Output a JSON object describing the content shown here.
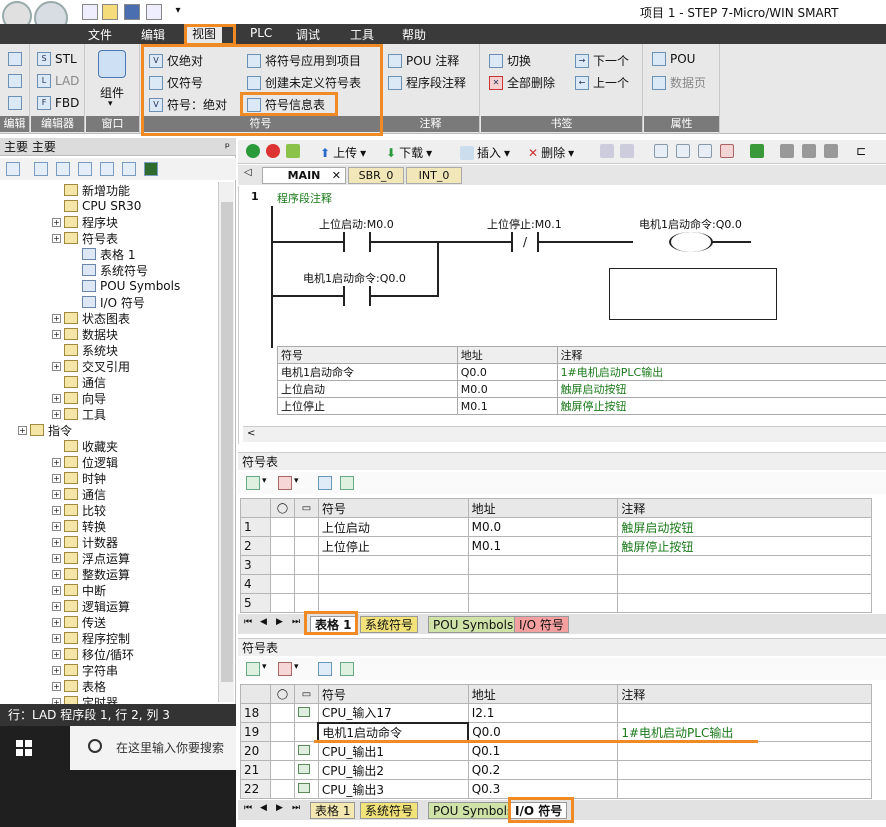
{
  "window": {
    "title": "项目 1 - STEP 7-Micro/WIN SMART"
  },
  "menu": [
    "文件",
    "编辑",
    "视图",
    "PLC",
    "调试",
    "工具",
    "帮助"
  ],
  "ribbon": {
    "editor_group": {
      "items": [
        "STL",
        "LAD",
        "FBD"
      ],
      "label": "编辑器"
    },
    "window_group": {
      "item": "组件",
      "label": "窗口"
    },
    "symbol_group": {
      "items": [
        "仅绝对",
        "仅符号",
        "符号：绝对",
        "将符号应用到项目",
        "创建未定义符号表",
        "符号信息表"
      ],
      "label": "符号"
    },
    "comment_group": {
      "items": [
        "POU 注释",
        "程序段注释"
      ],
      "label": "注释"
    },
    "bookmark_group": {
      "items": [
        "切换",
        "全部删除",
        "下一个",
        "上一个"
      ],
      "label": "书签"
    },
    "prop_group": {
      "items": [
        "POU",
        "数据页"
      ],
      "label": "属性"
    },
    "left_clip": "编辑"
  },
  "left_panel": {
    "header": "主要 主要",
    "tree": [
      {
        "label": "新增功能",
        "level": 2,
        "exp": false
      },
      {
        "label": "CPU SR30",
        "level": 2,
        "exp": false
      },
      {
        "label": "程序块",
        "level": 2,
        "exp": true
      },
      {
        "label": "符号表",
        "level": 2,
        "exp": true
      },
      {
        "label": "表格 1",
        "level": 3,
        "exp": false
      },
      {
        "label": "系统符号",
        "level": 3,
        "exp": false
      },
      {
        "label": "POU Symbols",
        "level": 3,
        "exp": false
      },
      {
        "label": "I/O 符号",
        "level": 3,
        "exp": false
      },
      {
        "label": "状态图表",
        "level": 2,
        "exp": true
      },
      {
        "label": "数据块",
        "level": 2,
        "exp": true
      },
      {
        "label": "系统块",
        "level": 2,
        "exp": false
      },
      {
        "label": "交叉引用",
        "level": 2,
        "exp": true
      },
      {
        "label": "通信",
        "level": 2,
        "exp": false
      },
      {
        "label": "向导",
        "level": 2,
        "exp": true
      },
      {
        "label": "工具",
        "level": 2,
        "exp": true
      },
      {
        "label": "指令",
        "level": 1,
        "exp": true
      },
      {
        "label": "收藏夹",
        "level": 2,
        "exp": false
      },
      {
        "label": "位逻辑",
        "level": 2,
        "exp": true
      },
      {
        "label": "时钟",
        "level": 2,
        "exp": true
      },
      {
        "label": "通信",
        "level": 2,
        "exp": true
      },
      {
        "label": "比较",
        "level": 2,
        "exp": true
      },
      {
        "label": "转换",
        "level": 2,
        "exp": true
      },
      {
        "label": "计数器",
        "level": 2,
        "exp": true
      },
      {
        "label": "浮点运算",
        "level": 2,
        "exp": true
      },
      {
        "label": "整数运算",
        "level": 2,
        "exp": true
      },
      {
        "label": "中断",
        "level": 2,
        "exp": true
      },
      {
        "label": "逻辑运算",
        "level": 2,
        "exp": true
      },
      {
        "label": "传送",
        "level": 2,
        "exp": true
      },
      {
        "label": "程序控制",
        "level": 2,
        "exp": true
      },
      {
        "label": "移位/循环",
        "level": 2,
        "exp": true
      },
      {
        "label": "字符串",
        "level": 2,
        "exp": true
      },
      {
        "label": "表格",
        "level": 2,
        "exp": true
      },
      {
        "label": "定时器",
        "level": 2,
        "exp": true
      }
    ]
  },
  "status": {
    "text": "行：LAD 程序段 1, 行 2, 列 3"
  },
  "taskbar": {
    "search_placeholder": "在这里输入你要搜索"
  },
  "editor": {
    "toolbar": {
      "upload": "上传",
      "download": "下载",
      "insert": "插入",
      "delete": "删除"
    },
    "tabs": [
      "MAIN",
      "SBR_0",
      "INT_0"
    ],
    "network_number": "1",
    "network_comment": "程序段注释",
    "contacts": {
      "c1": "上位启动:M0.0",
      "c2": "上位停止:M0.1",
      "coil": "电机1启动命令:Q0.0",
      "c3": "电机1启动命令:Q0.0",
      "not_symbol": "/"
    },
    "symtable": {
      "headers": [
        "符号",
        "地址",
        "注释"
      ],
      "rows": [
        [
          "电机1启动命令",
          "Q0.0",
          "1#电机启动PLC输出"
        ],
        [
          "上位启动",
          "M0.0",
          "触屏启动按钮"
        ],
        [
          "上位停止",
          "M0.1",
          "触屏停止按钮"
        ]
      ]
    }
  },
  "pane1": {
    "title": "符号表",
    "headers": [
      "符号",
      "地址",
      "注释"
    ],
    "rows": [
      [
        "1",
        "上位启动",
        "M0.0",
        "触屏启动按钮"
      ],
      [
        "2",
        "上位停止",
        "M0.1",
        "触屏停止按钮"
      ],
      [
        "3",
        "",
        "",
        ""
      ],
      [
        "4",
        "",
        "",
        ""
      ],
      [
        "5",
        "",
        "",
        ""
      ]
    ],
    "tabs": [
      "表格 1",
      "系统符号",
      "POU Symbols",
      "I/O 符号"
    ]
  },
  "pane2": {
    "title": "符号表",
    "headers": [
      "符号",
      "地址",
      "注释"
    ],
    "rows": [
      [
        "18",
        "CPU_输入17",
        "I2.1",
        ""
      ],
      [
        "19",
        "电机1启动命令",
        "Q0.0",
        "1#电机启动PLC输出"
      ],
      [
        "20",
        "CPU_输出1",
        "Q0.1",
        ""
      ],
      [
        "21",
        "CPU_输出2",
        "Q0.2",
        ""
      ],
      [
        "22",
        "CPU_输出3",
        "Q0.3",
        ""
      ]
    ],
    "tabs": [
      "表格 1",
      "系统符号",
      "POU Symbols",
      "I/O 符号"
    ]
  },
  "colors": {
    "highlight": "#f08a24",
    "menubar": "#3a3a3a",
    "comment_green": "#1a7a1a"
  }
}
